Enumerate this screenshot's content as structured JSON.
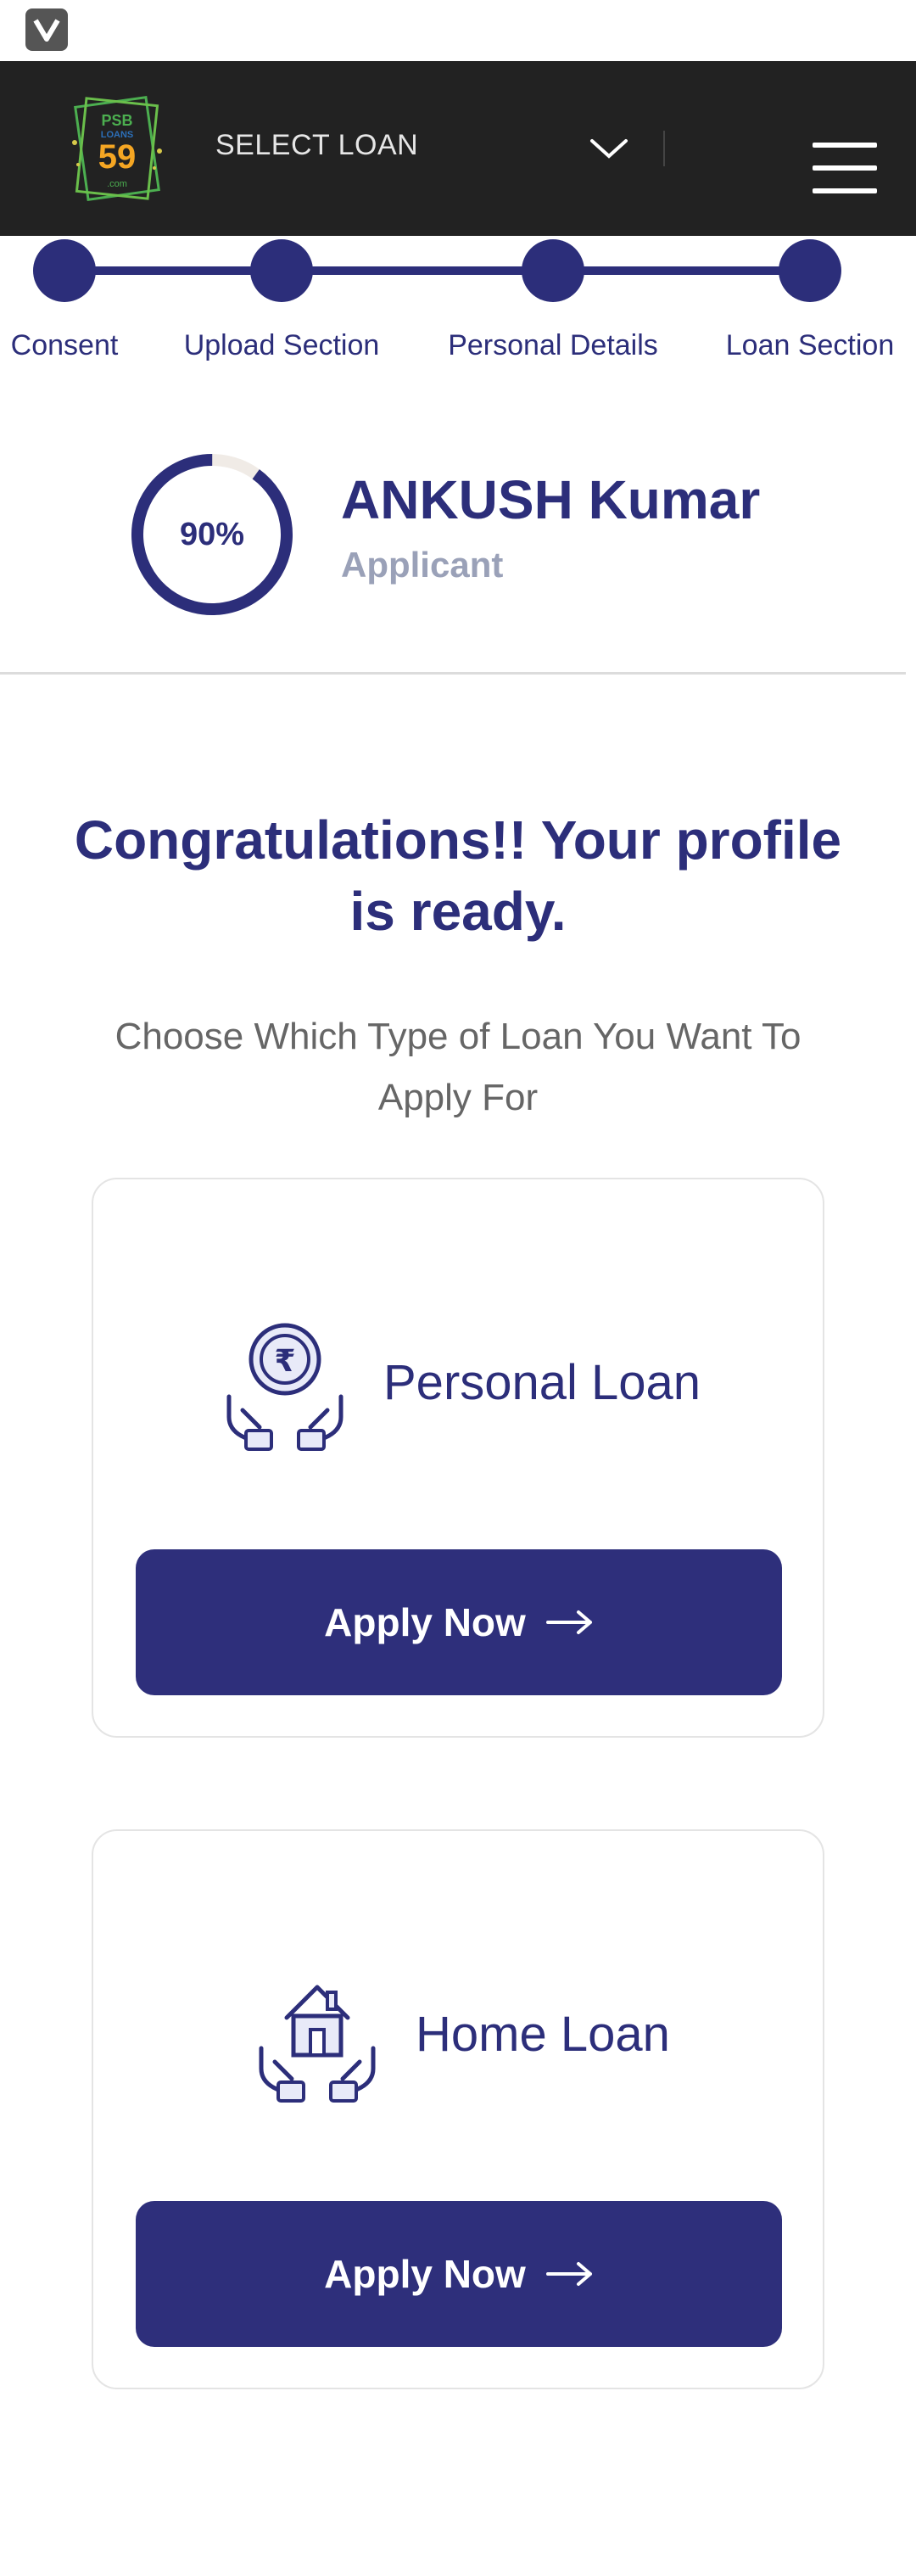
{
  "header": {
    "select_loan_label": "SELECT LOAN",
    "logo_text_top": "PSB",
    "logo_text_middle": "LOANS",
    "logo_text_number": "59",
    "logo_text_bottom": ".com",
    "logo_bg_color": "#222222",
    "logo_accent_green": "#4caf50",
    "logo_accent_orange": "#f5a623"
  },
  "stepper": {
    "steps": [
      {
        "label": "Consent"
      },
      {
        "label": "Upload Section"
      },
      {
        "label": "Personal Details"
      },
      {
        "label": "Loan Section"
      }
    ],
    "color": "#2c2e7a"
  },
  "profile": {
    "progress_text": "90%",
    "progress_fraction": 0.9,
    "name": "ANKUSH Kumar",
    "role": "Applicant"
  },
  "main": {
    "headline": "Congratulations!! Your profile is ready.",
    "subline": "Choose Which Type of Loan You Want To Apply For"
  },
  "loans": [
    {
      "title": "Personal Loan",
      "icon": "rupee-hands-icon",
      "button_label": "Apply Now"
    },
    {
      "title": "Home Loan",
      "icon": "house-hands-icon",
      "button_label": "Apply Now"
    }
  ],
  "colors": {
    "primary": "#2c2e7a",
    "button": "#2e2f7b",
    "muted": "#9aa1b8",
    "topbar": "#222222"
  }
}
